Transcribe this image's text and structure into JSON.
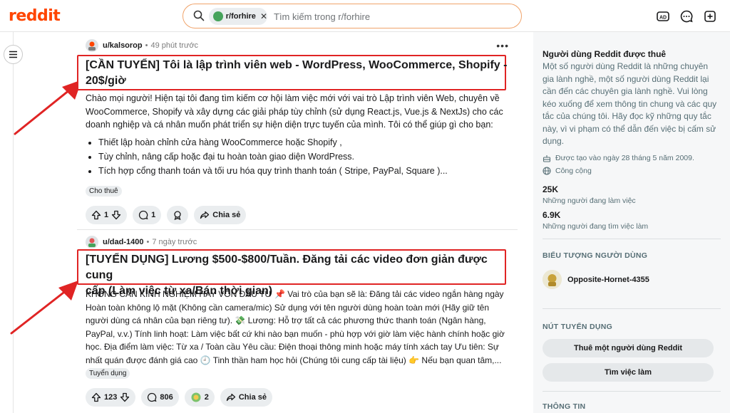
{
  "header": {
    "logo": "reddit",
    "search_chip": "r/forhire",
    "search_placeholder": "Tìm kiếm trong r/forhire",
    "icons": [
      "ad-icon",
      "chat-icon",
      "create-post-icon"
    ]
  },
  "posts": [
    {
      "user": "u/kalsorop",
      "time": "49 phút trước",
      "title_line1": "[CẦN TUYỂN] Tôi là lập trình viên web - WordPress, WooCommerce, Shopify -",
      "title_line2": "20$/giờ",
      "body_lines": [
        "Chào mọi người! Hiện tại tôi đang tìm kiếm cơ hội làm việc mới với vai trò Lập trình viên Web, chuyên về",
        "WooCommerce, Shopify và xây dựng các giải pháp tùy chỉnh (sử dụng React.js, Vue.js & NextJs) cho các",
        "doanh nghiệp và cá nhân muốn phát triển sự hiện diện trực tuyến của mình. Tôi có thể giúp gì cho bạn:"
      ],
      "bullets": [
        "Thiết lập hoàn chỉnh cửa hàng WooCommerce hoặc Shopify ,",
        "Tùy chỉnh, nâng cấp hoặc đại tu hoàn toàn giao diện WordPress.",
        "Tích hợp cổng thanh toán và tối ưu hóa quy trình thanh toán ( Stripe, PayPal, Square )..."
      ],
      "flair": "Cho thuê",
      "votes": "1",
      "comments": "1",
      "share": "Chia sẻ"
    },
    {
      "user": "u/dad-1400",
      "time": "7 ngày trước",
      "title_line1": "[TUYỂN DỤNG] Lương $500-$800/Tuần. Đăng tải các video đơn giản được cung",
      "title_line2": "cấp (Làm việc từ xa/Bán thời gian)",
      "body_lines": [
        "KHÔNG CẦN KINH NGHIỆM HAY VỐN ĐẦU TƯ 📌 Vai trò của bạn sẽ là: Đăng tải các video ngắn hàng ngày",
        "Hoàn toàn không lộ mặt (Không cần camera/mic) Sử dụng với tên người dùng hoàn toàn mới (Hãy giữ tên",
        "người dùng cá nhân của bạn riêng tư). 💸 Lương: Hỗ trợ tất cả các phương thức thanh toán (Ngân hàng,",
        "PayPal, v.v.) Tính linh hoạt: Làm việc bất cứ khi nào bạn muốn - phù hợp với giờ làm việc hành chính hoặc giờ",
        "học. Địa điểm làm việc: Từ xa / Toàn cầu Yêu cầu: Điện thoại thông minh hoặc máy tính xách tay Ưu tiên: Sự",
        "nhất quán được đánh giá cao 🕘 Tinh thần ham học hỏi (Chúng tôi cung cấp tài liệu) 👉 Nếu bạn quan tâm,..."
      ],
      "flair": "Tuyển dụng",
      "votes": "123",
      "comments": "806",
      "awards": "2",
      "share": "Chia sẻ"
    }
  ],
  "sidebar": {
    "title": "Người dùng Reddit được thuê",
    "description": "Một số người dùng Reddit là những chuyên gia lành nghề, một số người dùng Reddit lại cần đến các chuyên gia lành nghề. Vui lòng kéo xuống để xem thông tin chung và các quy tắc của chúng tôi. Hãy đọc kỹ những quy tắc này, vì vi phạm có thể dẫn đến việc bị cấm sử dụng.",
    "created": "Được tạo vào ngày 28 tháng 5 năm 2009.",
    "visibility": "Công cộng",
    "stat1_value": "25K",
    "stat1_label": "Những người đang làm việc",
    "stat2_value": "6.9K",
    "stat2_label": "Những người đang tìm việc làm",
    "user_flair_heading": "BIỂU TƯỢNG NGƯỜI DÙNG",
    "flair_user": "Opposite-Hornet-4355",
    "buttons_heading": "NÚT TUYỂN DỤNG",
    "button1": "Thuê một người dùng Reddit",
    "button2": "Tìm việc làm",
    "info_heading": "THÔNG TIN"
  },
  "colors": {
    "brand": "#ff4500",
    "highlight_box": "#e02424",
    "arrow": "#e02424"
  }
}
